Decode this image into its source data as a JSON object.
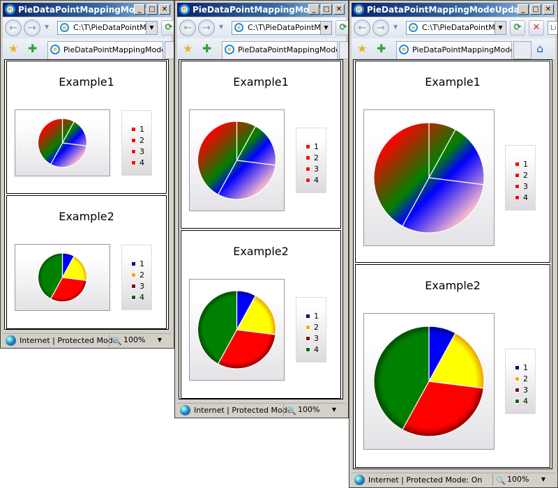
{
  "windows": [
    {
      "title": "PieDataPointMappingMode...",
      "address": "C:\\T\\PieDataPointMap",
      "tab_label": "PieDataPointMappingMode...",
      "status_text": "Internet | Protected Mode",
      "zoom": "100%"
    },
    {
      "title": "PieDataPointMappingMode...",
      "address": "C:\\T\\PieDataPointMap",
      "tab_label": "PieDataPointMappingMode...",
      "status_text": "Internet | Protected Mode",
      "zoom": "100%"
    },
    {
      "title": "PieDataPointMappingModeUpdater - ...",
      "address": "C:\\T\\PieDataPointMap",
      "tab_label": "PieDataPointMappingMode...",
      "status_text": "Internet | Protected Mode: On",
      "zoom": "100%",
      "search_placeholder": "Li"
    }
  ],
  "chart_data": [
    {
      "type": "pie",
      "title": "Example1",
      "categories": [
        "1",
        "2",
        "3",
        "4"
      ],
      "values": [
        8,
        19,
        31,
        42
      ],
      "fill": "shared diagonal gradient",
      "gradient_colors": [
        "#FF0000",
        "#008000",
        "#0000FF",
        "#FFC0CB"
      ],
      "legend": {
        "position": "right",
        "colors": [
          "#FF0000",
          "#FF0000",
          "#FF0000",
          "#FF0000"
        ]
      }
    },
    {
      "type": "pie",
      "title": "Example2",
      "categories": [
        "1",
        "2",
        "3",
        "4"
      ],
      "values": [
        8,
        19,
        31,
        42
      ],
      "slice_colors": [
        "#0000FF",
        "#FFFF00",
        "#FF0000",
        "#008000"
      ],
      "legend": {
        "position": "right",
        "colors": [
          "#00008B",
          "#FFA500",
          "#8B0000",
          "#006400"
        ]
      }
    }
  ]
}
